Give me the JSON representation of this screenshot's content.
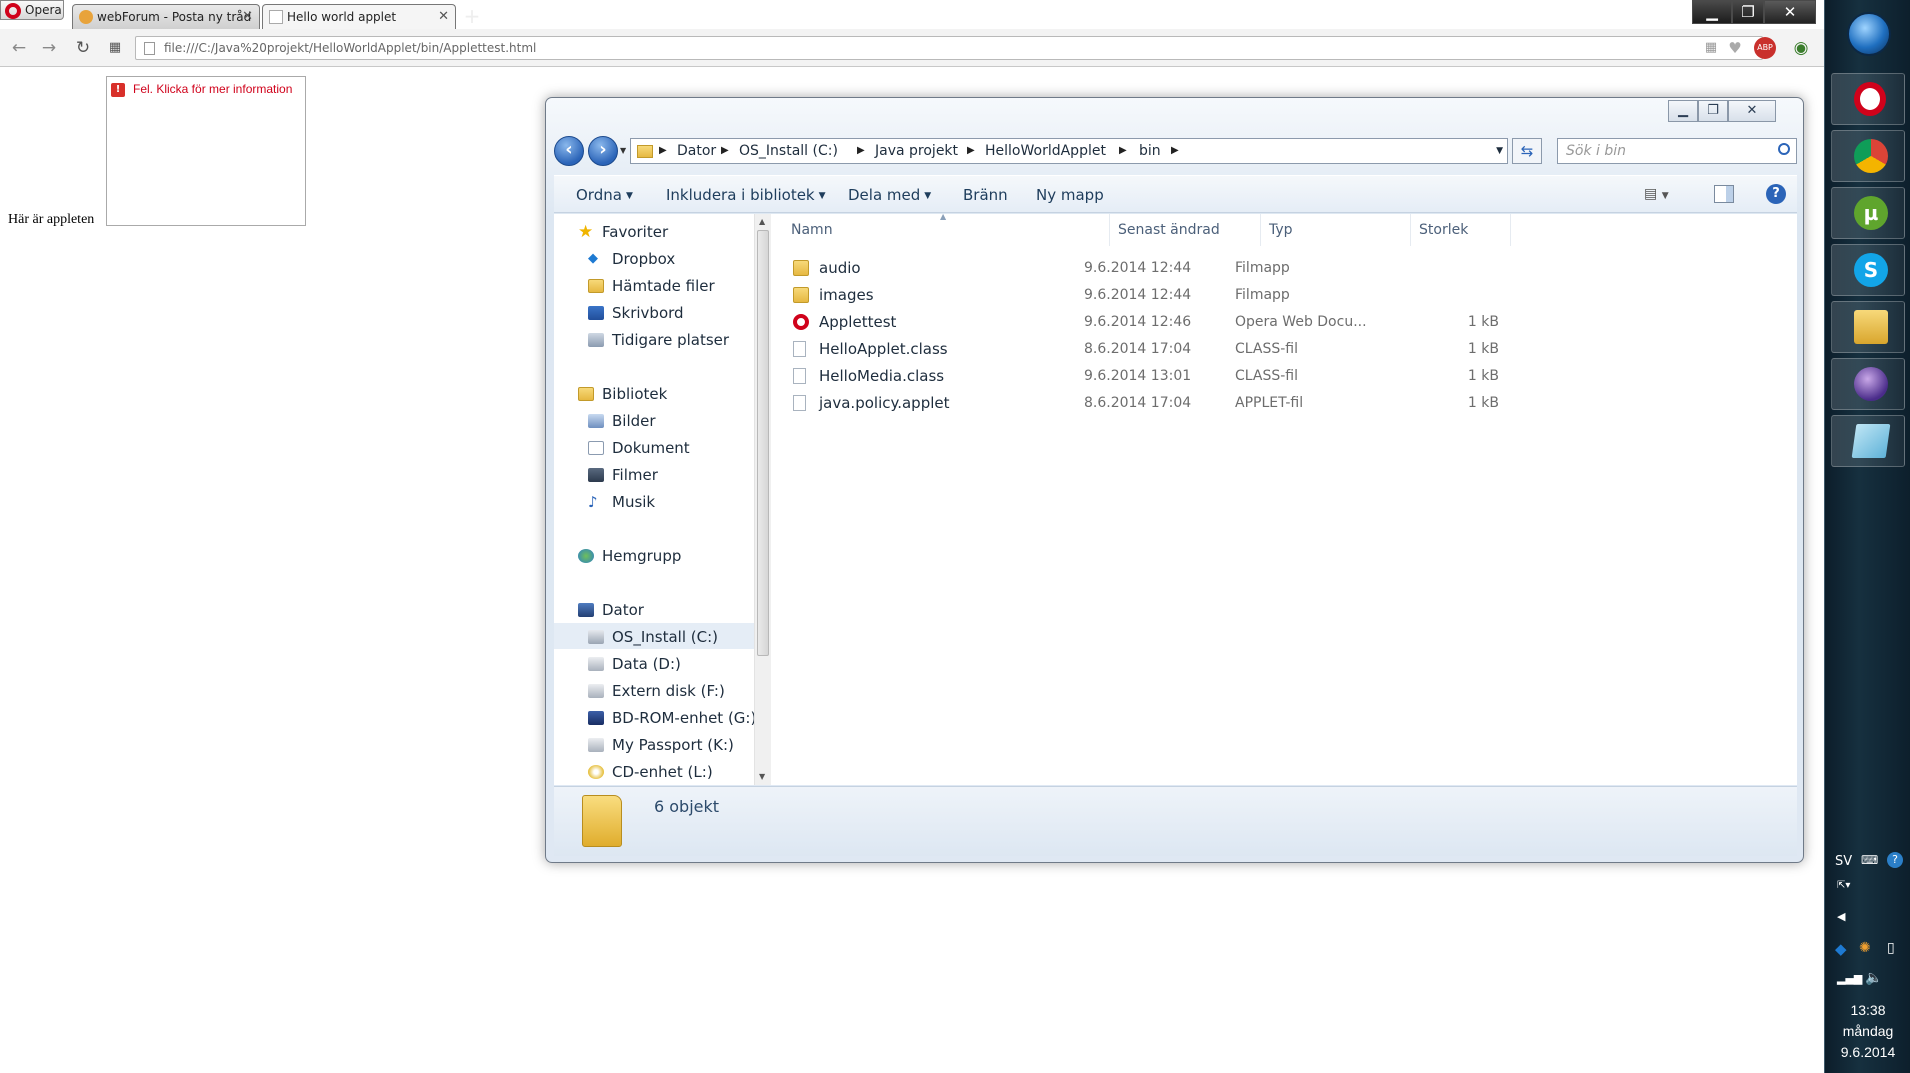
{
  "browser": {
    "menu_label": "Opera",
    "tabs": [
      {
        "label": "webForum - Posta ny tråd"
      },
      {
        "label": "Hello world applet"
      }
    ],
    "window_controls": {
      "minimize": "▁",
      "restore": "❐",
      "close": "✕"
    },
    "url": "file:///C:/Java%20projekt/HelloWorldApplet/bin/Applettest.html"
  },
  "page": {
    "applet_error": "Fel.  Klicka för mer information",
    "caption": "Här är appleten"
  },
  "explorer": {
    "window_controls": {
      "minimize": "▁",
      "restore": "❐",
      "close": "✕"
    },
    "breadcrumb": [
      "Dator",
      "OS_Install (C:)",
      "Java projekt",
      "HelloWorldApplet",
      "bin"
    ],
    "search_placeholder": "Sök i bin",
    "toolbar": {
      "organize": "Ordna",
      "include": "Inkludera i bibliotek",
      "share": "Dela med",
      "burn": "Bränn",
      "new_folder": "Ny mapp"
    },
    "nav": {
      "favorites": "Favoriter",
      "favorites_items": [
        "Dropbox",
        "Hämtade filer",
        "Skrivbord",
        "Tidigare platser"
      ],
      "libraries": "Bibliotek",
      "libraries_items": [
        "Bilder",
        "Dokument",
        "Filmer",
        "Musik"
      ],
      "homegroup": "Hemgrupp",
      "computer": "Dator",
      "computer_items": [
        "OS_Install (C:)",
        "Data (D:)",
        "Extern disk (F:)",
        "BD-ROM-enhet (G:) N",
        "My Passport (K:)",
        "CD-enhet (L:)"
      ]
    },
    "columns": {
      "name": "Namn",
      "date": "Senast ändrad",
      "type": "Typ",
      "size": "Storlek"
    },
    "files": [
      {
        "name": "audio",
        "date": "9.6.2014 12:44",
        "type": "Filmapp",
        "size": "",
        "icon": "folder-icon"
      },
      {
        "name": "images",
        "date": "9.6.2014 12:44",
        "type": "Filmapp",
        "size": "",
        "icon": "folder-icon"
      },
      {
        "name": "Applettest",
        "date": "9.6.2014 12:46",
        "type": "Opera Web Docu...",
        "size": "1 kB",
        "icon": "opera-icon"
      },
      {
        "name": "HelloApplet.class",
        "date": "8.6.2014 17:04",
        "type": "CLASS-fil",
        "size": "1 kB",
        "icon": "file-icon"
      },
      {
        "name": "HelloMedia.class",
        "date": "9.6.2014 13:01",
        "type": "CLASS-fil",
        "size": "1 kB",
        "icon": "file-icon"
      },
      {
        "name": "java.policy.applet",
        "date": "8.6.2014 17:04",
        "type": "APPLET-fil",
        "size": "1 kB",
        "icon": "file-icon"
      }
    ],
    "status": "6 objekt"
  },
  "taskbar": {
    "language": "SV",
    "clock_time": "13:38",
    "clock_day": "måndag",
    "clock_date": "9.6.2014"
  }
}
